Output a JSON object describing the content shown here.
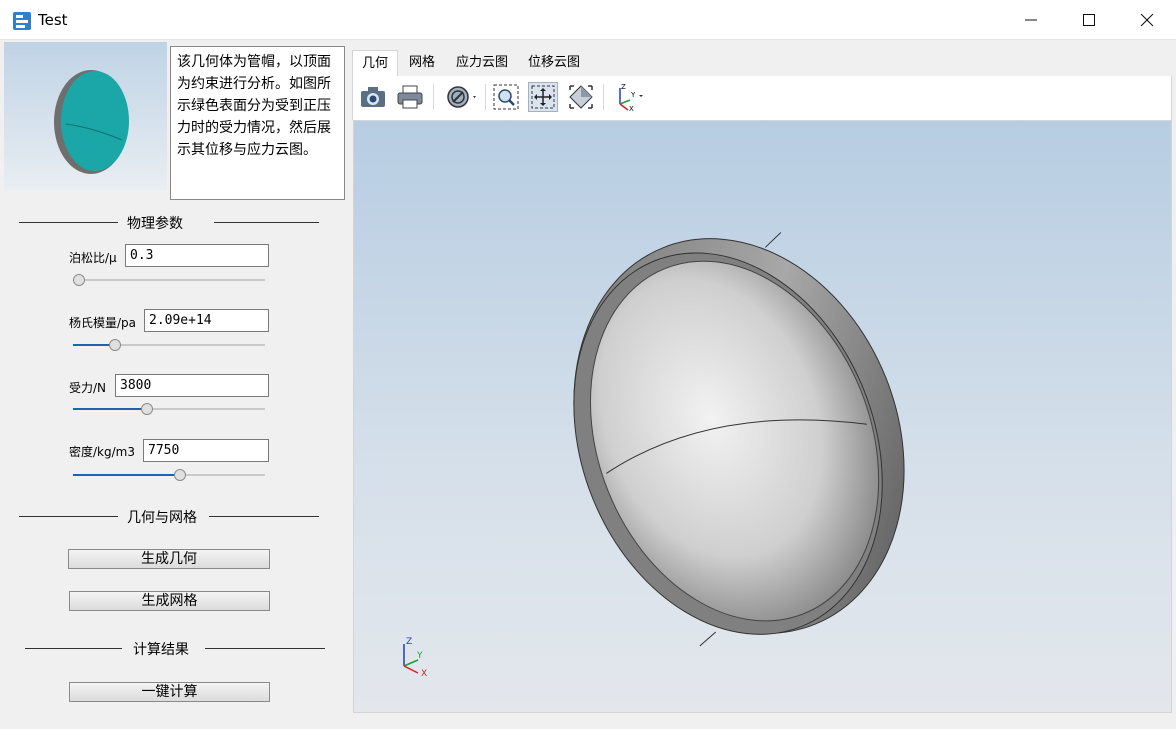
{
  "window": {
    "title": "Test",
    "minimize_label": "—",
    "maximize_label": "☐",
    "close_label": "✕"
  },
  "description": "该几何体为管帽，以顶面为约束进行分析。如图所示绿色表面分为受到正压力时的受力情况，然后展示其位移与应力云图。",
  "sections": {
    "physical": "物理参数",
    "geometry_mesh": "几何与网格",
    "results": "计算结果"
  },
  "params": {
    "poisson": {
      "label": "泊松比/μ",
      "value": "0.3",
      "slider_fraction": 0.0
    },
    "youngs": {
      "label": "杨氏模量/pa",
      "value": "2.09e+14",
      "slider_fraction": 0.2
    },
    "force": {
      "label": "受力/N",
      "value": "3800",
      "slider_fraction": 0.38
    },
    "density": {
      "label": "密度/kg/m3",
      "value": "7750",
      "slider_fraction": 0.56
    }
  },
  "buttons": {
    "gen_geometry": "生成几何",
    "gen_mesh": "生成网格",
    "compute": "一键计算"
  },
  "tabs": [
    "几何",
    "网格",
    "应力云图",
    "位移云图"
  ],
  "active_tab": 0,
  "toolbar": [
    "camera-icon",
    "printer-icon",
    "hide-icon",
    "zoom-box-icon",
    "fit-all-icon",
    "view-iso-icon",
    "axes-icon"
  ],
  "axes_triad": {
    "x": "X",
    "y": "Y",
    "z": "Z"
  },
  "colors": {
    "accent": "#1e63b0",
    "preview_surface": "#1ba7a7",
    "model_surface": "#9a9a9a"
  }
}
